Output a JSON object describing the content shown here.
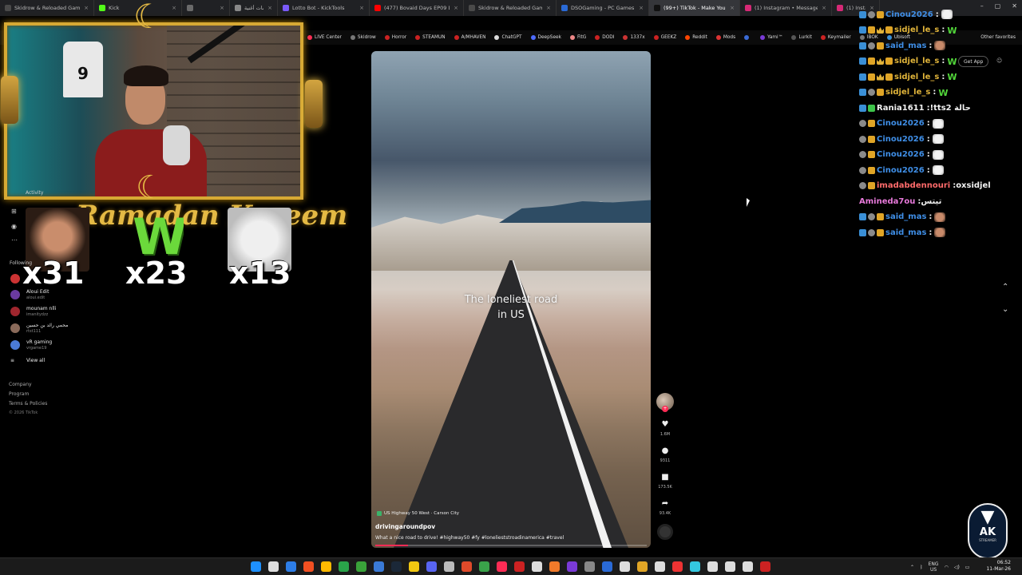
{
  "browser": {
    "tabs": [
      {
        "label": "Skidrow & Reloaded Games – D",
        "color": "#4a4a4a"
      },
      {
        "label": "Kick",
        "color": "#53fc18"
      },
      {
        "label": "",
        "color": "#6a6a6a"
      },
      {
        "label": "طلب كلمات أغنية",
        "color": "#888"
      },
      {
        "label": "Lotto Bot - KickTools",
        "color": "#7a5af8"
      },
      {
        "label": "(477) Bovaid Days EP09 Docteur",
        "color": "#ff0000"
      },
      {
        "label": "Skidrow & Reloaded Games – P",
        "color": "#4a4a4a"
      },
      {
        "label": "DSOGaming - PC Games News, S",
        "color": "#2a6ad6"
      },
      {
        "label": "(99+) TikTok - Make Your Day",
        "color": "#111"
      },
      {
        "label": "(1) Instagram • Messages",
        "color": "#d62976"
      },
      {
        "label": "(1) Instagram",
        "color": "#d62976"
      }
    ],
    "window_controls": [
      "–",
      "▢",
      "✕"
    ],
    "bookmarks": [
      {
        "label": "LIVE Center",
        "color": "#fe2c55"
      },
      {
        "label": "Skidrow",
        "color": "#777"
      },
      {
        "label": "Horror",
        "color": "#c22"
      },
      {
        "label": "STEAMUN",
        "color": "#c22"
      },
      {
        "label": "A/MHAVEN",
        "color": "#c22"
      },
      {
        "label": "ChatGPT",
        "color": "#ddd"
      },
      {
        "label": "DeepSeek",
        "color": "#4d6bfe"
      },
      {
        "label": "FitG",
        "color": "#e88"
      },
      {
        "label": "DODI",
        "color": "#c22"
      },
      {
        "label": "1337x",
        "color": "#c33"
      },
      {
        "label": "GEEKZ",
        "color": "#c22"
      },
      {
        "label": "Reddit",
        "color": "#ff4500"
      },
      {
        "label": "Mods",
        "color": "#d33"
      },
      {
        "label": "",
        "color": "#3a6ad6"
      },
      {
        "label": "Yami™",
        "color": "#7a3ad6"
      },
      {
        "label": "Lurkit",
        "color": "#555"
      },
      {
        "label": "Keymailer",
        "color": "#c22"
      },
      {
        "label": "IBOK",
        "color": "#777"
      },
      {
        "label": "Ubisoft",
        "color": "#3a8fd6"
      }
    ],
    "other_favorites": "Other favorites"
  },
  "tiktok": {
    "get_app": "Get App",
    "sidebar": {
      "activity_label": "Activity",
      "following_label": "Following",
      "following": [
        {
          "name": "",
          "handle": "",
          "color": "#c33"
        },
        {
          "name": "Aloui Edit",
          "handle": "aloui.edit",
          "color": "#6a3aa0"
        },
        {
          "name": "mounam nlli",
          "handle": "imanitydzz",
          "color": "#a0262e"
        },
        {
          "name": "محمي رائد بن حسين",
          "handle": "rtst111",
          "color": "#8a6a5a"
        },
        {
          "name": "vR gaming",
          "handle": "vrgame19",
          "color": "#4a7ad6"
        }
      ],
      "view_all": "View all",
      "footer": [
        "Company",
        "Program",
        "Terms & Policies"
      ],
      "copyright": "© 2026 TikTok"
    },
    "video": {
      "overlay_text_line1": "The loneliest road",
      "overlay_text_line2": "in US",
      "location": "US Highway 50 West · Carson City",
      "author": "drivingaroundpov",
      "description": "What a nice road to drive! #highway50 #fy #lonelieststroadinamerica #travel",
      "progress": 0.12
    },
    "actions": [
      {
        "icon": "heart-icon",
        "glyph": "♥",
        "count": "1.6M"
      },
      {
        "icon": "comment-icon",
        "glyph": "●",
        "count": "9311"
      },
      {
        "icon": "bookmark-icon",
        "glyph": "■",
        "count": "173.5K"
      },
      {
        "icon": "share-icon",
        "glyph": "➦",
        "count": "93.4K"
      }
    ]
  },
  "stream_overlay": {
    "banner": "Ramadan Kareem",
    "jersey_number": "9",
    "emote_counts": [
      "x31",
      "x23",
      "x13"
    ],
    "w_glyph": "W"
  },
  "chat": [
    {
      "badges": [
        "blue",
        "gray",
        "gold"
      ],
      "user": "Cinou2026",
      "color": "#3f8ee6",
      "msg": "",
      "emote": "cat"
    },
    {
      "badges": [
        "blue",
        "gold",
        "crown",
        "gold"
      ],
      "user": "sidjel_le_s",
      "color": "#e0b43a",
      "msg": "",
      "emote": "w"
    },
    {
      "badges": [
        "blue",
        "gray",
        "gold"
      ],
      "user": "said_mas",
      "color": "#3f8ee6",
      "msg": "",
      "emote": "face"
    },
    {
      "badges": [
        "blue",
        "gold",
        "crown",
        "gold"
      ],
      "user": "sidjel_le_s",
      "color": "#e0b43a",
      "msg": "",
      "emote": "w"
    },
    {
      "badges": [
        "blue",
        "gold",
        "crown",
        "gold"
      ],
      "user": "sidjel_le_s",
      "color": "#e0b43a",
      "msg": "",
      "emote": "w"
    },
    {
      "badges": [
        "blue",
        "gray",
        "gold"
      ],
      "user": "sidjel_le_s",
      "color": "#e0b43a",
      "msg": "",
      "emote": "w"
    },
    {
      "badges": [
        "blue",
        "green"
      ],
      "user": "Rania1611",
      "color": "#f2f2f2",
      "msg": "!tts2 حالة",
      "emote": ""
    },
    {
      "badges": [
        "gray",
        "gold"
      ],
      "user": "Cinou2026",
      "color": "#3f8ee6",
      "msg": "",
      "emote": "cat"
    },
    {
      "badges": [
        "gray",
        "gold"
      ],
      "user": "Cinou2026",
      "color": "#3f8ee6",
      "msg": "",
      "emote": "cat"
    },
    {
      "badges": [
        "gray",
        "gold"
      ],
      "user": "Cinou2026",
      "color": "#3f8ee6",
      "msg": "",
      "emote": "cat"
    },
    {
      "badges": [
        "gray",
        "gold"
      ],
      "user": "Cinou2026",
      "color": "#3f8ee6",
      "msg": "",
      "emote": "cat"
    },
    {
      "badges": [
        "gray",
        "gold"
      ],
      "user": "imadabdennouri",
      "color": "#ff6b6b",
      "msg": "oxsidjel",
      "emote": ""
    },
    {
      "badges": [],
      "user": "Amineda7ou",
      "color": "#e87adb",
      "msg": "تيتس",
      "emote": ""
    },
    {
      "badges": [
        "blue",
        "gray",
        "gold"
      ],
      "user": "said_mas",
      "color": "#3f8ee6",
      "msg": "",
      "emote": "face"
    },
    {
      "badges": [
        "blue",
        "gray",
        "gold"
      ],
      "user": "said_mas",
      "color": "#3f8ee6",
      "msg": "",
      "emote": "face"
    }
  ],
  "logo": {
    "text": "AK",
    "sub": "STREAMER"
  },
  "taskbar": {
    "icons": [
      "#1e90ff",
      "#ddd",
      "#2d7de6",
      "#f25022",
      "#ffb900",
      "#2aa34a",
      "#3aa33a",
      "#3a7ad6",
      "#1b2838",
      "#f2c811",
      "#5865f2",
      "#bbb",
      "#e04a2a",
      "#3aa34a",
      "#fe2c55",
      "#c22",
      "#ddd",
      "#f07a2a",
      "#7a3ad6",
      "#888",
      "#2a6ad6",
      "#ddd",
      "#e0a526",
      "#ddd",
      "#e33",
      "#34c8e0",
      "#ddd",
      "#ddd",
      "#ddd",
      "#c22"
    ],
    "lang": "ENG",
    "region": "US",
    "time": "06:52",
    "date": "11-Mar-26"
  }
}
